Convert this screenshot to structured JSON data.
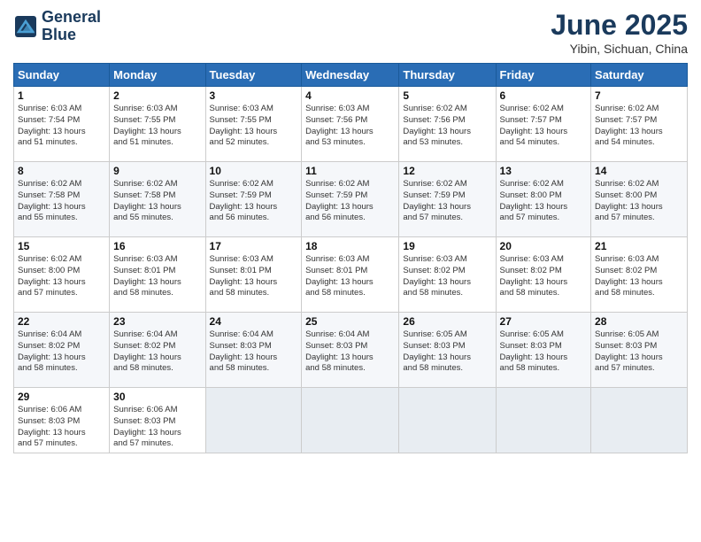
{
  "header": {
    "logo_line1": "General",
    "logo_line2": "Blue",
    "month_title": "June 2025",
    "subtitle": "Yibin, Sichuan, China"
  },
  "weekdays": [
    "Sunday",
    "Monday",
    "Tuesday",
    "Wednesday",
    "Thursday",
    "Friday",
    "Saturday"
  ],
  "weeks": [
    [
      {
        "day": "1",
        "info": "Sunrise: 6:03 AM\nSunset: 7:54 PM\nDaylight: 13 hours\nand 51 minutes."
      },
      {
        "day": "2",
        "info": "Sunrise: 6:03 AM\nSunset: 7:55 PM\nDaylight: 13 hours\nand 51 minutes."
      },
      {
        "day": "3",
        "info": "Sunrise: 6:03 AM\nSunset: 7:55 PM\nDaylight: 13 hours\nand 52 minutes."
      },
      {
        "day": "4",
        "info": "Sunrise: 6:03 AM\nSunset: 7:56 PM\nDaylight: 13 hours\nand 53 minutes."
      },
      {
        "day": "5",
        "info": "Sunrise: 6:02 AM\nSunset: 7:56 PM\nDaylight: 13 hours\nand 53 minutes."
      },
      {
        "day": "6",
        "info": "Sunrise: 6:02 AM\nSunset: 7:57 PM\nDaylight: 13 hours\nand 54 minutes."
      },
      {
        "day": "7",
        "info": "Sunrise: 6:02 AM\nSunset: 7:57 PM\nDaylight: 13 hours\nand 54 minutes."
      }
    ],
    [
      {
        "day": "8",
        "info": "Sunrise: 6:02 AM\nSunset: 7:58 PM\nDaylight: 13 hours\nand 55 minutes."
      },
      {
        "day": "9",
        "info": "Sunrise: 6:02 AM\nSunset: 7:58 PM\nDaylight: 13 hours\nand 55 minutes."
      },
      {
        "day": "10",
        "info": "Sunrise: 6:02 AM\nSunset: 7:59 PM\nDaylight: 13 hours\nand 56 minutes."
      },
      {
        "day": "11",
        "info": "Sunrise: 6:02 AM\nSunset: 7:59 PM\nDaylight: 13 hours\nand 56 minutes."
      },
      {
        "day": "12",
        "info": "Sunrise: 6:02 AM\nSunset: 7:59 PM\nDaylight: 13 hours\nand 57 minutes."
      },
      {
        "day": "13",
        "info": "Sunrise: 6:02 AM\nSunset: 8:00 PM\nDaylight: 13 hours\nand 57 minutes."
      },
      {
        "day": "14",
        "info": "Sunrise: 6:02 AM\nSunset: 8:00 PM\nDaylight: 13 hours\nand 57 minutes."
      }
    ],
    [
      {
        "day": "15",
        "info": "Sunrise: 6:02 AM\nSunset: 8:00 PM\nDaylight: 13 hours\nand 57 minutes."
      },
      {
        "day": "16",
        "info": "Sunrise: 6:03 AM\nSunset: 8:01 PM\nDaylight: 13 hours\nand 58 minutes."
      },
      {
        "day": "17",
        "info": "Sunrise: 6:03 AM\nSunset: 8:01 PM\nDaylight: 13 hours\nand 58 minutes."
      },
      {
        "day": "18",
        "info": "Sunrise: 6:03 AM\nSunset: 8:01 PM\nDaylight: 13 hours\nand 58 minutes."
      },
      {
        "day": "19",
        "info": "Sunrise: 6:03 AM\nSunset: 8:02 PM\nDaylight: 13 hours\nand 58 minutes."
      },
      {
        "day": "20",
        "info": "Sunrise: 6:03 AM\nSunset: 8:02 PM\nDaylight: 13 hours\nand 58 minutes."
      },
      {
        "day": "21",
        "info": "Sunrise: 6:03 AM\nSunset: 8:02 PM\nDaylight: 13 hours\nand 58 minutes."
      }
    ],
    [
      {
        "day": "22",
        "info": "Sunrise: 6:04 AM\nSunset: 8:02 PM\nDaylight: 13 hours\nand 58 minutes."
      },
      {
        "day": "23",
        "info": "Sunrise: 6:04 AM\nSunset: 8:02 PM\nDaylight: 13 hours\nand 58 minutes."
      },
      {
        "day": "24",
        "info": "Sunrise: 6:04 AM\nSunset: 8:03 PM\nDaylight: 13 hours\nand 58 minutes."
      },
      {
        "day": "25",
        "info": "Sunrise: 6:04 AM\nSunset: 8:03 PM\nDaylight: 13 hours\nand 58 minutes."
      },
      {
        "day": "26",
        "info": "Sunrise: 6:05 AM\nSunset: 8:03 PM\nDaylight: 13 hours\nand 58 minutes."
      },
      {
        "day": "27",
        "info": "Sunrise: 6:05 AM\nSunset: 8:03 PM\nDaylight: 13 hours\nand 58 minutes."
      },
      {
        "day": "28",
        "info": "Sunrise: 6:05 AM\nSunset: 8:03 PM\nDaylight: 13 hours\nand 57 minutes."
      }
    ],
    [
      {
        "day": "29",
        "info": "Sunrise: 6:06 AM\nSunset: 8:03 PM\nDaylight: 13 hours\nand 57 minutes."
      },
      {
        "day": "30",
        "info": "Sunrise: 6:06 AM\nSunset: 8:03 PM\nDaylight: 13 hours\nand 57 minutes."
      },
      {
        "day": "",
        "info": ""
      },
      {
        "day": "",
        "info": ""
      },
      {
        "day": "",
        "info": ""
      },
      {
        "day": "",
        "info": ""
      },
      {
        "day": "",
        "info": ""
      }
    ]
  ]
}
